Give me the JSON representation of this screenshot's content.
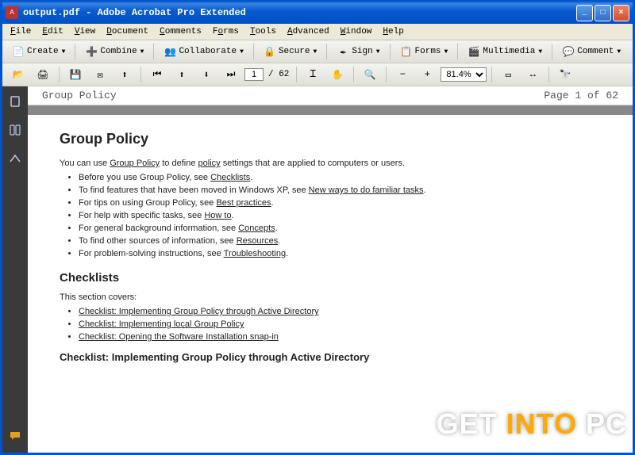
{
  "titlebar": {
    "title": "output.pdf - Adobe Acrobat Pro Extended"
  },
  "menu": {
    "items": [
      "File",
      "Edit",
      "View",
      "Document",
      "Comments",
      "Forms",
      "Tools",
      "Advanced",
      "Window",
      "Help"
    ]
  },
  "toolbar1": {
    "create": "Create",
    "combine": "Combine",
    "collaborate": "Collaborate",
    "secure": "Secure",
    "sign": "Sign",
    "forms": "Forms",
    "multimedia": "Multimedia",
    "comment": "Comment"
  },
  "toolbar2": {
    "page_current": "1",
    "page_total": "/ 62",
    "zoom": "81.4%"
  },
  "doc": {
    "header_left": "Group Policy",
    "header_right": "Page 1 of 62",
    "h1": "Group Policy",
    "intro_pre": "You can use ",
    "intro_link1": "Group Policy",
    "intro_mid": " to define ",
    "intro_link2": "policy",
    "intro_post": " settings that are applied to computers or users.",
    "bullets": [
      {
        "pre": "Before you use Group Policy, see ",
        "link": "Checklists",
        "post": "."
      },
      {
        "pre": "To find features that have been moved in Windows XP, see ",
        "link": "New ways to do familiar tasks",
        "post": "."
      },
      {
        "pre": "For tips on using Group Policy, see ",
        "link": "Best practices",
        "post": "."
      },
      {
        "pre": "For help with specific tasks, see ",
        "link": "How to",
        "post": "."
      },
      {
        "pre": "For general background information, see ",
        "link": "Concepts",
        "post": "."
      },
      {
        "pre": "To find other sources of information, see ",
        "link": "Resources",
        "post": "."
      },
      {
        "pre": "For problem-solving instructions, see ",
        "link": "Troubleshooting",
        "post": "."
      }
    ],
    "h2": "Checklists",
    "section_intro": "This section covers:",
    "check_bullets": [
      "Checklist: Implementing Group Policy through Active Directory",
      "Checklist: Implementing local Group Policy",
      "Checklist: Opening the Software Installation snap-in"
    ],
    "h3": "Checklist: Implementing Group Policy through Active Directory"
  },
  "watermark": {
    "w1": "GET",
    "w2": "INTO",
    "w3": "PC"
  }
}
